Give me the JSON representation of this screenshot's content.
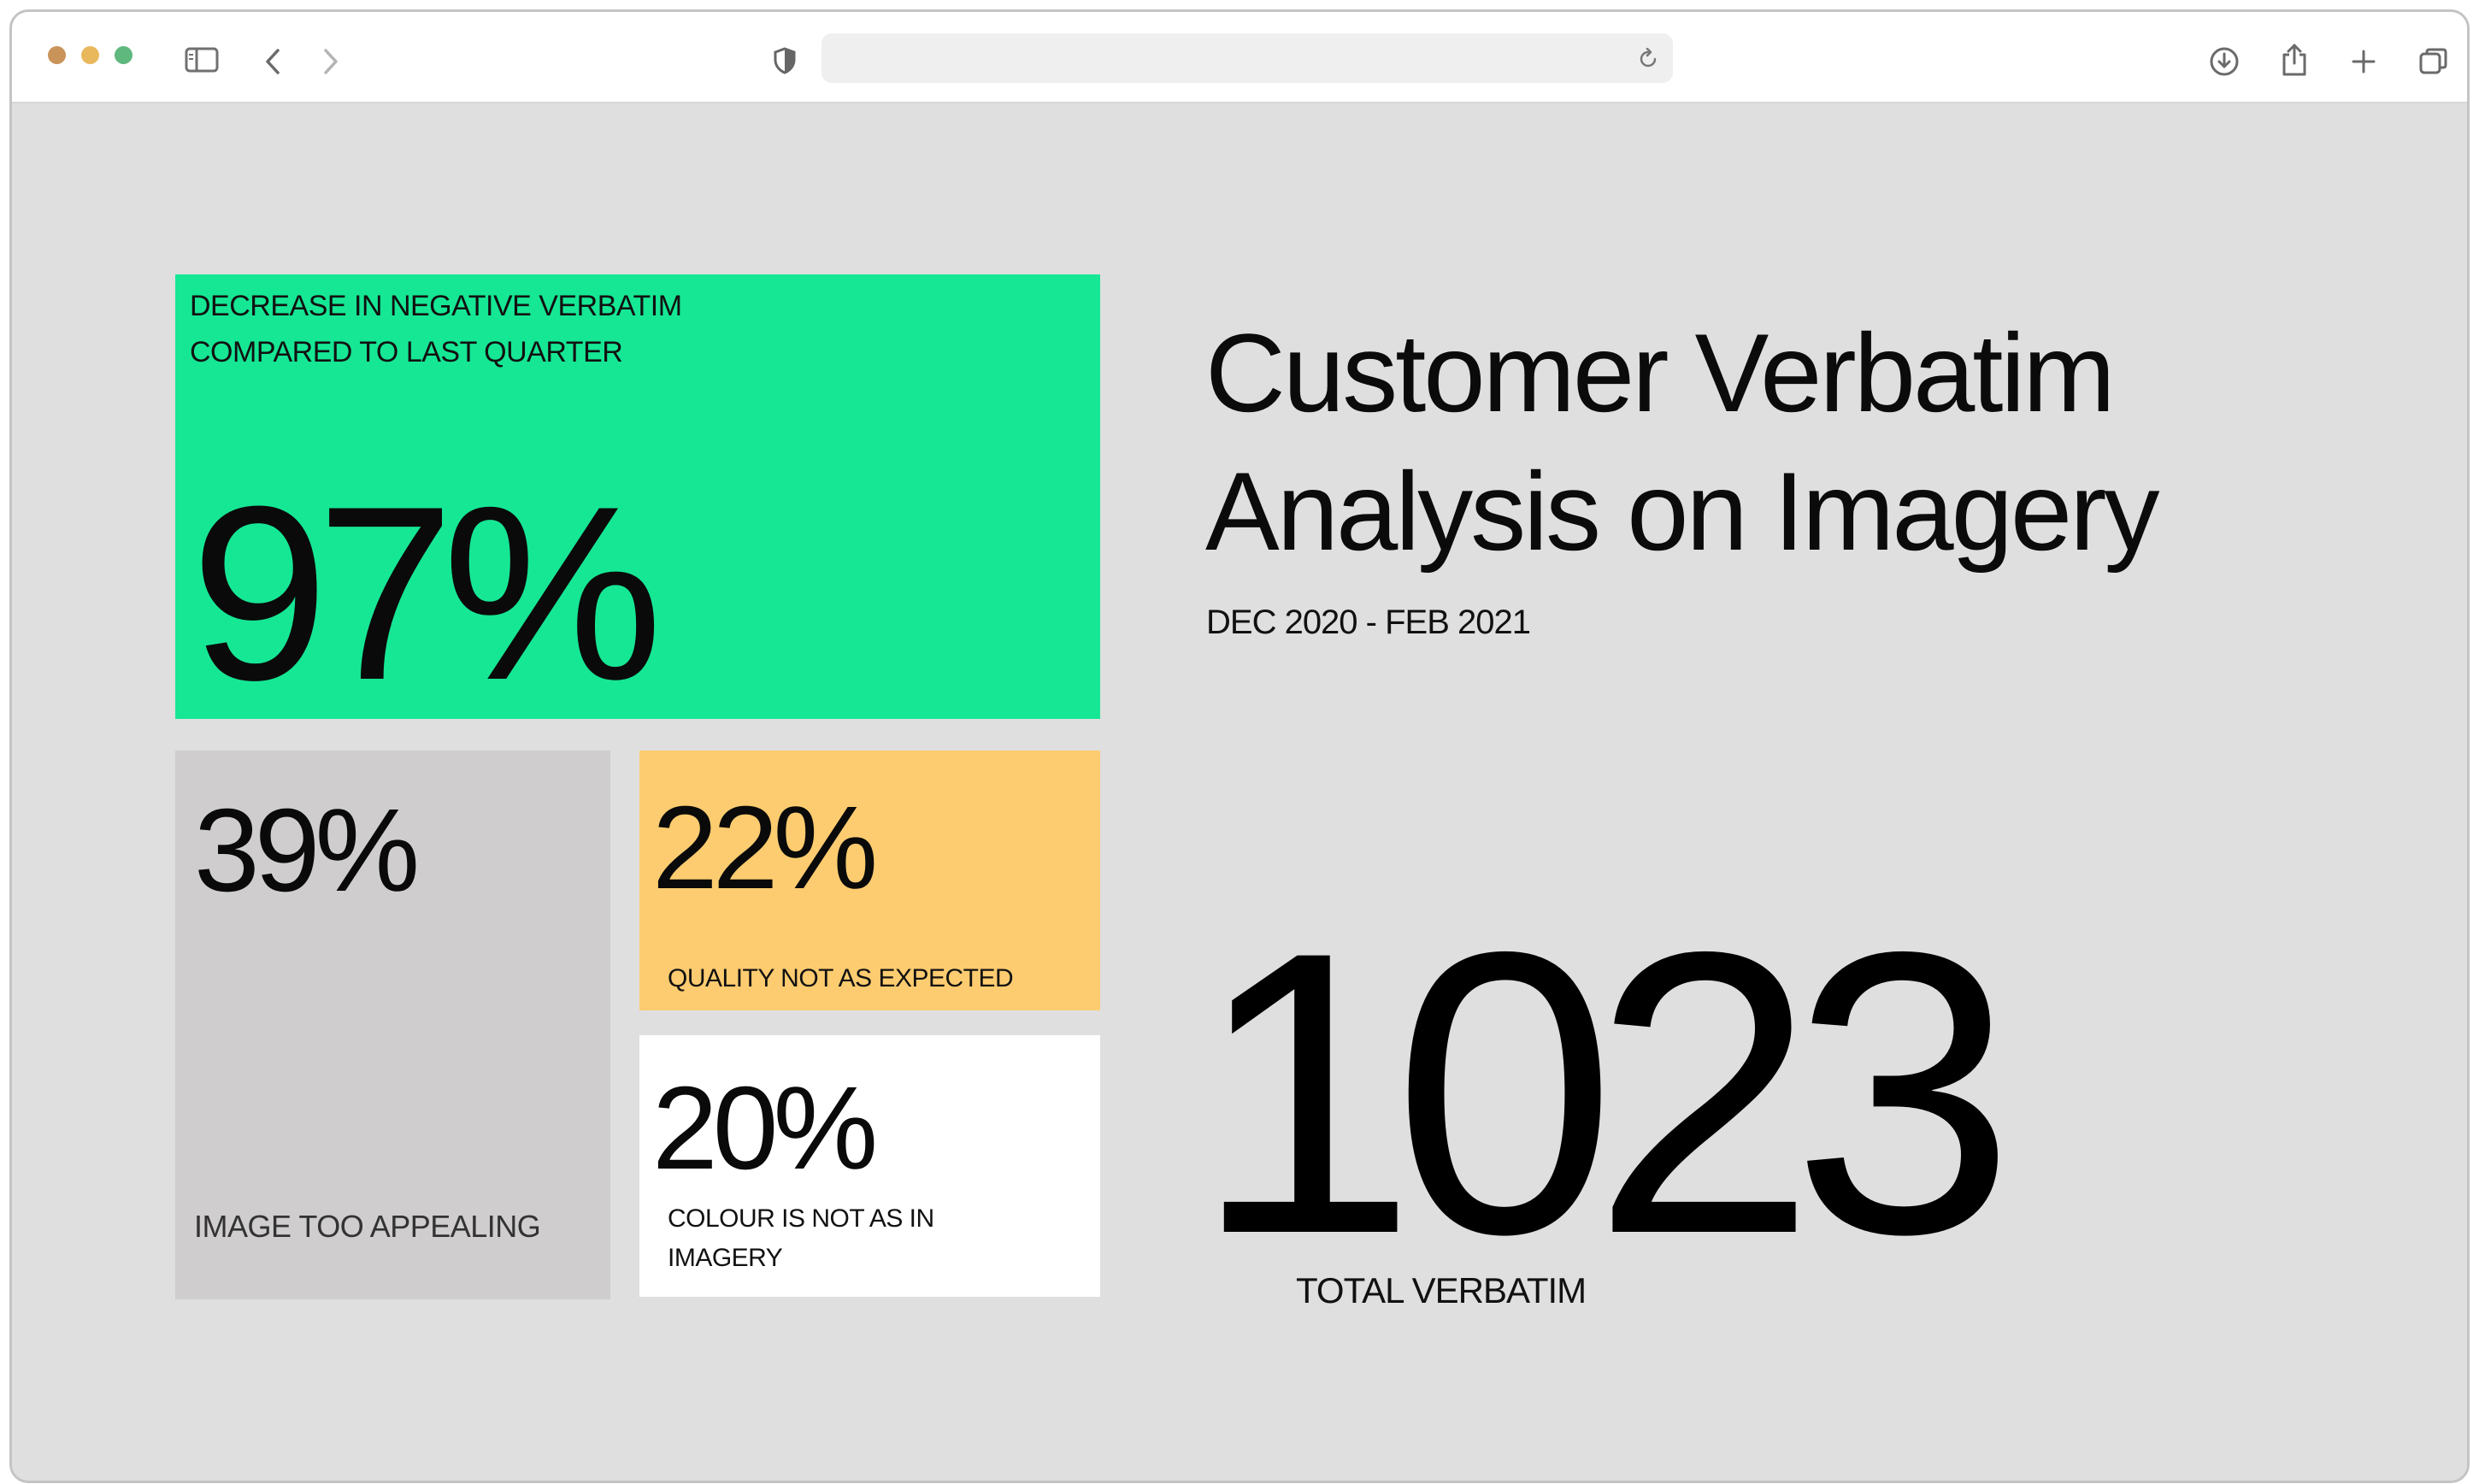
{
  "browser": {
    "traffic_lights": [
      {
        "name": "close",
        "color": "#c9935a"
      },
      {
        "name": "minimize",
        "color": "#e9b85d"
      },
      {
        "name": "zoom",
        "color": "#5fb87e"
      }
    ],
    "toolbar_icons": {
      "sidebar": "sidebar-icon",
      "back": "chevron-left-icon",
      "forward": "chevron-right-icon",
      "privacy": "shield-icon",
      "reload": "reload-icon",
      "download": "download-icon",
      "share": "share-icon",
      "new_tab": "plus-icon",
      "tabs": "tabs-overview-icon"
    },
    "address_value": ""
  },
  "colors": {
    "green_tile": "#16e795",
    "gray_tile": "#cfcdcd",
    "amber_tile": "#fdcc70",
    "white_tile": "#ffffff",
    "page_background": "#dfdfdf"
  },
  "tiles": {
    "headline": {
      "label_line1": "DECREASE IN NEGATIVE VERBATIM",
      "label_line2": "COMPARED TO LAST QUARTER",
      "value": "97%"
    },
    "too_appealing": {
      "value": "39%",
      "label": "IMAGE TOO APPEALING"
    },
    "quality": {
      "value": "22%",
      "label": "QUALITY NOT AS EXPECTED"
    },
    "colour": {
      "value": "20%",
      "label_line1": "COLOUR IS NOT AS IN",
      "label_line2": "IMAGERY"
    }
  },
  "report": {
    "title_line1": "Customer Verbatim",
    "title_line2": "Analysis on Imagery",
    "date_range": "DEC 2020 - FEB 2021",
    "total_value": "1023",
    "total_label": "TOTAL VERBATIM"
  }
}
